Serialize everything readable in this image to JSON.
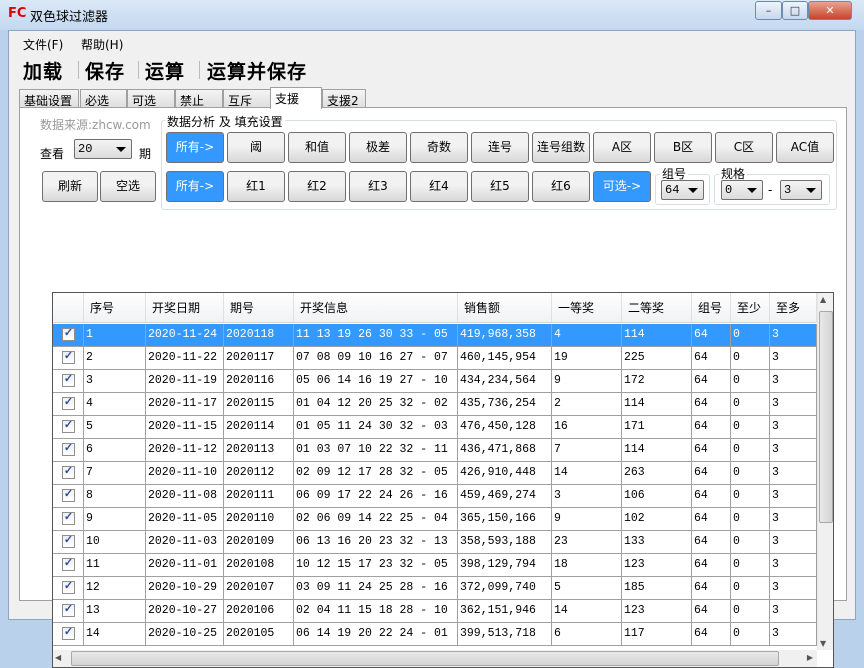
{
  "window": {
    "logo": "FC",
    "title": "双色球过滤器",
    "controls": [
      "–",
      "□",
      "✕"
    ]
  },
  "menu": [
    "文件(F)",
    "帮助(H)"
  ],
  "toolbar": [
    "加载",
    "保存",
    "运算",
    "运算并保存"
  ],
  "tabs": [
    "基础设置",
    "必选",
    "可选",
    "禁止",
    "互斥",
    "支援",
    "支援2"
  ],
  "selected_tab": "支援",
  "left": {
    "source": "数据来源:zhcw.com",
    "view_label": "查看",
    "view_value": "20",
    "period_label": "期",
    "refresh": "刷新",
    "clear": "空选"
  },
  "group": {
    "title": "数据分析 及 填充设置",
    "row1": [
      "所有->",
      "阈",
      "和值",
      "极差",
      "奇数",
      "连号",
      "连号组数",
      "A区",
      "B区",
      "C区",
      "AC值"
    ],
    "row2": [
      "所有->",
      "红1",
      "红2",
      "红3",
      "红4",
      "红5",
      "红6",
      "可选->"
    ],
    "group_no_label": "组号",
    "group_no_value": "64",
    "spec_label": "规格",
    "spec_min": "0",
    "spec_dash": "-",
    "spec_max": "3"
  },
  "table": {
    "columns": [
      "",
      "序号",
      "开奖日期",
      "期号",
      "开奖信息",
      "销售额",
      "一等奖",
      "二等奖",
      "组号",
      "至少",
      "至多"
    ],
    "rows": [
      [
        "1",
        "2020-11-24",
        "2020118",
        "11 13 19 26 30 33 - 05",
        "419,968,358",
        "4",
        "114",
        "64",
        "0",
        "3"
      ],
      [
        "2",
        "2020-11-22",
        "2020117",
        "07 08 09 10 16 27 - 07",
        "460,145,954",
        "19",
        "225",
        "64",
        "0",
        "3"
      ],
      [
        "3",
        "2020-11-19",
        "2020116",
        "05 06 14 16 19 27 - 10",
        "434,234,564",
        "9",
        "172",
        "64",
        "0",
        "3"
      ],
      [
        "4",
        "2020-11-17",
        "2020115",
        "01 04 12 20 25 32 - 02",
        "435,736,254",
        "2",
        "114",
        "64",
        "0",
        "3"
      ],
      [
        "5",
        "2020-11-15",
        "2020114",
        "01 05 11 24 30 32 - 03",
        "476,450,128",
        "16",
        "171",
        "64",
        "0",
        "3"
      ],
      [
        "6",
        "2020-11-12",
        "2020113",
        "01 03 07 10 22 32 - 11",
        "436,471,868",
        "7",
        "114",
        "64",
        "0",
        "3"
      ],
      [
        "7",
        "2020-11-10",
        "2020112",
        "02 09 12 17 28 32 - 05",
        "426,910,448",
        "14",
        "263",
        "64",
        "0",
        "3"
      ],
      [
        "8",
        "2020-11-08",
        "2020111",
        "06 09 17 22 24 26 - 16",
        "459,469,274",
        "3",
        "106",
        "64",
        "0",
        "3"
      ],
      [
        "9",
        "2020-11-05",
        "2020110",
        "02 06 09 14 22 25 - 04",
        "365,150,166",
        "9",
        "102",
        "64",
        "0",
        "3"
      ],
      [
        "10",
        "2020-11-03",
        "2020109",
        "06 13 16 20 23 32 - 13",
        "358,593,188",
        "23",
        "133",
        "64",
        "0",
        "3"
      ],
      [
        "11",
        "2020-11-01",
        "2020108",
        "10 12 15 17 23 32 - 05",
        "398,129,794",
        "18",
        "123",
        "64",
        "0",
        "3"
      ],
      [
        "12",
        "2020-10-29",
        "2020107",
        "03 09 11 24 25 28 - 16",
        "372,099,740",
        "5",
        "185",
        "64",
        "0",
        "3"
      ],
      [
        "13",
        "2020-10-27",
        "2020106",
        "02 04 11 15 18 28 - 10",
        "362,151,946",
        "14",
        "123",
        "64",
        "0",
        "3"
      ],
      [
        "14",
        "2020-10-25",
        "2020105",
        "06 14 19 20 22 24 - 01",
        "399,513,718",
        "6",
        "117",
        "64",
        "0",
        "3"
      ]
    ],
    "selected_row": 0,
    "checked": true
  },
  "colors": {
    "accent": "#3399ff",
    "logo": "#e00000"
  }
}
